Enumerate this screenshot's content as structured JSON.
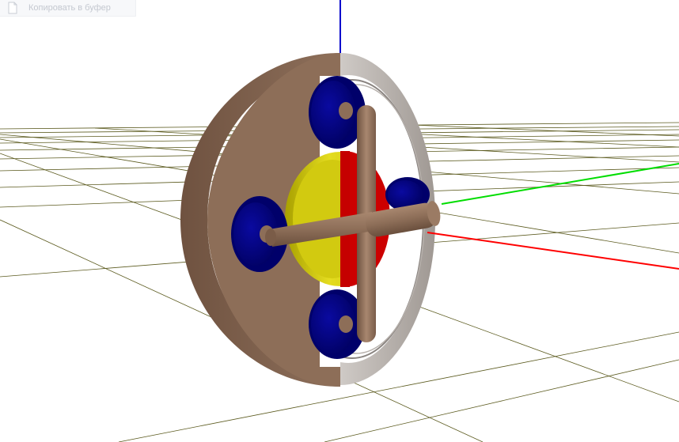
{
  "toolbar": {
    "copy_label": "Копировать в буфер",
    "copy_icon": "document-icon"
  },
  "scene": {
    "background": "#ffffff",
    "grid_color": "#5b5a1e",
    "axis_colors": {
      "x": "#ff0000",
      "y": "#00dd00",
      "z": "#0000cc"
    },
    "part_colors": {
      "disk_face": "#8d6e58",
      "disk_rim": "#7a5b46",
      "back_ring": "#a9a39e",
      "rollers": "#000080",
      "hub": "#c8c000",
      "hub_inner": "#cc0000",
      "cross_arms": "#8f6f59"
    }
  }
}
